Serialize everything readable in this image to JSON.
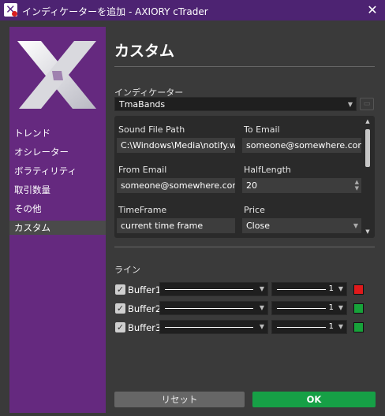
{
  "window": {
    "title": "インディケーターを追加 - AXIORY cTrader",
    "close_glyph": "✕"
  },
  "sidebar": {
    "items": [
      {
        "label": "トレンド",
        "active": false
      },
      {
        "label": "オシレーター",
        "active": false
      },
      {
        "label": "ボラティリティ",
        "active": false
      },
      {
        "label": "取引数量",
        "active": false
      },
      {
        "label": "その他",
        "active": false
      },
      {
        "label": "カスタム",
        "active": true
      }
    ]
  },
  "main": {
    "title": "カスタム",
    "indicator_label": "インディケーター",
    "indicator_value": "TmaBands",
    "params": {
      "sound_file_path": {
        "label": "Sound File Path",
        "value": "C:\\Windows\\Media\\notify.wav"
      },
      "to_email": {
        "label": "To Email",
        "value": "someone@somewhere.com"
      },
      "from_email": {
        "label": "From Email",
        "value": "someone@somewhere.com"
      },
      "half_length": {
        "label": "HalfLength",
        "value": "20"
      },
      "timeframe": {
        "label": "TimeFrame",
        "value": "current time frame"
      },
      "price": {
        "label": "Price",
        "value": "Close"
      }
    },
    "lines_label": "ライン",
    "buffers": [
      {
        "label": "Buffer1",
        "checked": true,
        "thickness": "1",
        "color": "#e0191b"
      },
      {
        "label": "Buffer2",
        "checked": true,
        "thickness": "1",
        "color": "#17a33a"
      },
      {
        "label": "Buffer3",
        "checked": true,
        "thickness": "1",
        "color": "#17a33a"
      }
    ]
  },
  "footer": {
    "reset_label": "リセット",
    "ok_label": "OK"
  },
  "icons": {
    "app": "cTrader-logo-icon",
    "close": "close-icon",
    "camera": "camera-icon",
    "dropdown": "chevron-down-icon"
  }
}
